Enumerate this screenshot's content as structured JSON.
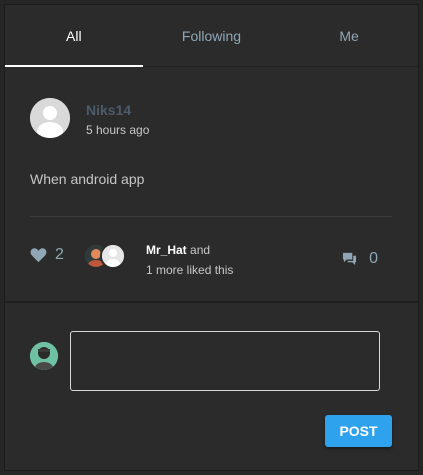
{
  "tabs": [
    {
      "label": "All",
      "active": true
    },
    {
      "label": "Following",
      "active": false
    },
    {
      "label": "Me",
      "active": false
    }
  ],
  "post": {
    "author": "Niks14",
    "time": "5 hours ago",
    "content": "When android app",
    "likes": {
      "count": "2",
      "first_name": "Mr_Hat",
      "and_word": "and",
      "rest_text": "1 more liked this"
    },
    "comments": {
      "count": "0"
    }
  },
  "compose": {
    "value": "",
    "post_label": "POST"
  },
  "colors": {
    "background": "#2b2b2b",
    "accent": "#2ea2ec",
    "muted_blue": "#8fa6b4"
  },
  "icons": {
    "like": "heart-icon",
    "comment": "comment-icon"
  }
}
